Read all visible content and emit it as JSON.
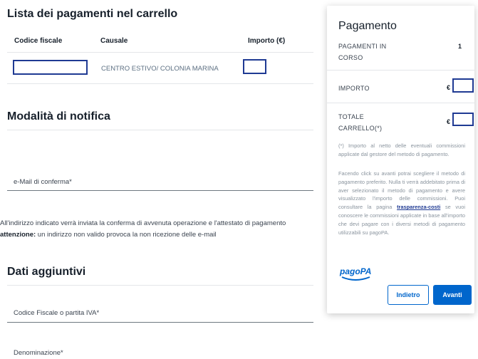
{
  "cart": {
    "title": "Lista dei pagamenti nel carrello",
    "columns": [
      "Codice fiscale",
      "Causale",
      "Importo (€)"
    ],
    "rows": [
      {
        "causale": "CENTRO ESTIVO/ COLONIA MARINA"
      }
    ]
  },
  "notification": {
    "title": "Modalità di notifica",
    "email_label": "e-Mail di conferma*",
    "info_text": "All'indirizzo indicato verrà inviata la conferma di avvenuta operazione e l'attestato di pagamento",
    "warning_label": "attenzione:",
    "warning_text": " un indirizzo non valido provoca la non ricezione delle e-mail"
  },
  "extra": {
    "title": "Dati aggiuntivi",
    "fiscal_label": "Codice Fiscale o partita IVA*",
    "name_label": "Denominazione*"
  },
  "payment": {
    "title": "Pagamento",
    "in_progress_label": "PAGAMENTI IN CORSO",
    "in_progress_value": "1",
    "amount_label": "IMPORTO",
    "currency": "€",
    "total_label": "TOTALE CARRELLO(*)",
    "note": "(*) Importo al netto delle eventuali commissioni applicate dal gestore del metodo di pagamento.",
    "info_before": "Facendo click su avanti potrai scegliere il metodo di pagamento preferito. Nulla ti verrà addebitato prima di aver selezionato il metodo di pagamento e avere visualizzato l'importo delle commissioni. Puoi consultare la pagina ",
    "info_link": "trasparenza-costi",
    "info_after": " se vuoi conoscere le commissioni applicate in base all'importo che devi pagare con i diversi metodi di pagamento utilizzabili su pagoPA.",
    "logo": "pagoPA",
    "back_label": "Indietro",
    "next_label": "Avanti"
  },
  "colors": {
    "accent": "#0066cc",
    "mask_border": "#1f3a93"
  }
}
